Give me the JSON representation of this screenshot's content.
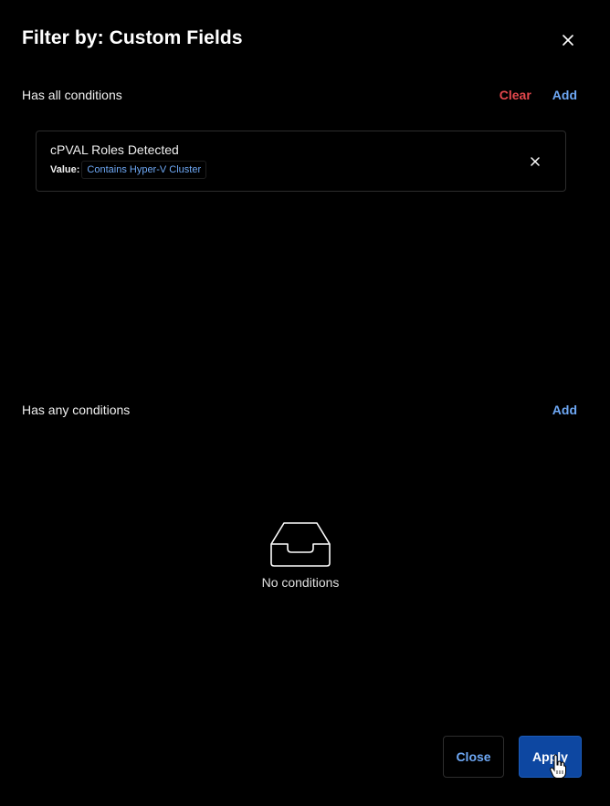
{
  "modal": {
    "title": "Filter by: Custom Fields",
    "close_icon": "close-icon"
  },
  "all_conditions": {
    "title": "Has all conditions",
    "clear_label": "Clear",
    "add_label": "Add",
    "items": [
      {
        "name": "cPVAL Roles Detected",
        "value_label": "Value:",
        "value": "Contains Hyper-V Cluster",
        "remove_icon": "close-icon"
      }
    ]
  },
  "any_conditions": {
    "title": "Has any conditions",
    "add_label": "Add",
    "empty_icon": "inbox-tray-icon",
    "empty_text": "No conditions"
  },
  "footer": {
    "close_label": "Close",
    "apply_label": "Apply"
  },
  "colors": {
    "background": "#000000",
    "link_blue": "#6ea8f5",
    "clear_red": "#e5484d",
    "primary_button": "#0d47a1"
  }
}
